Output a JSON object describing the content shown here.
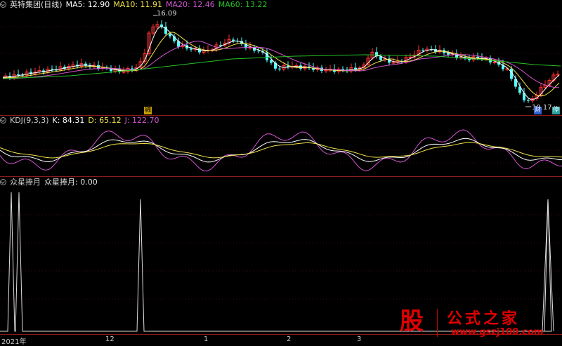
{
  "main": {
    "title": "英特集团(日线)",
    "ma5": "MA5: 12.90",
    "ma10": "MA10: 11.91",
    "ma20": "MA20: 12.46",
    "ma60": "MA60: 13.22",
    "high_label": "16.09",
    "low_label": "10.17",
    "badge_a": "融",
    "badge_b": "财",
    "badge_c": "停"
  },
  "kdj": {
    "title": "KDJ(9,3,3)",
    "k": "K: 84.31",
    "d": "D: 65.12",
    "j": "J: 122.70"
  },
  "custom": {
    "title": "众星捧月",
    "value": "众星捧月: 0.00"
  },
  "xaxis": {
    "labels": [
      "2021年",
      "12",
      "1",
      "2",
      "3"
    ]
  },
  "watermark": {
    "logo_char": "股",
    "name": "公式之家",
    "url": "www.gszj100.com"
  },
  "colors": {
    "ma5": "#ffffff",
    "ma10": "#f2e24a",
    "ma20": "#d255d2",
    "ma60": "#27c127",
    "up": "#ff3232",
    "down": "#54ffff",
    "divider": "#8b1a1a",
    "kdj_k": "#ffffff",
    "kdj_d": "#f2e24a",
    "kdj_j": "#d255d2"
  }
}
